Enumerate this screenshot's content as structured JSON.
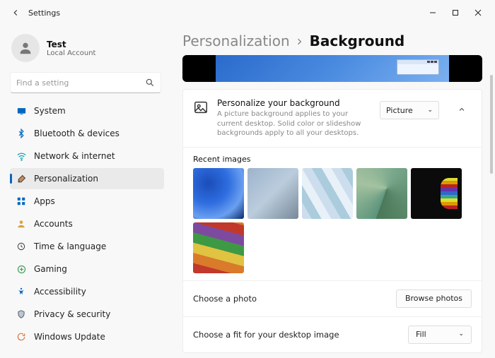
{
  "window": {
    "title": "Settings"
  },
  "profile": {
    "name": "Test",
    "subtitle": "Local Account"
  },
  "search": {
    "placeholder": "Find a setting"
  },
  "sidebar": {
    "items": [
      {
        "label": "System"
      },
      {
        "label": "Bluetooth & devices"
      },
      {
        "label": "Network & internet"
      },
      {
        "label": "Personalization"
      },
      {
        "label": "Apps"
      },
      {
        "label": "Accounts"
      },
      {
        "label": "Time & language"
      },
      {
        "label": "Gaming"
      },
      {
        "label": "Accessibility"
      },
      {
        "label": "Privacy & security"
      },
      {
        "label": "Windows Update"
      }
    ]
  },
  "breadcrumb": {
    "parent": "Personalization",
    "sep": "›",
    "current": "Background"
  },
  "background_card": {
    "title": "Personalize your background",
    "desc": "A picture background applies to your current desktop. Solid color or slideshow backgrounds apply to all your desktops.",
    "dropdown_value": "Picture"
  },
  "recent": {
    "title": "Recent images"
  },
  "choose_photo": {
    "label": "Choose a photo",
    "button": "Browse photos"
  },
  "choose_fit": {
    "label": "Choose a fit for your desktop image",
    "value": "Fill"
  }
}
